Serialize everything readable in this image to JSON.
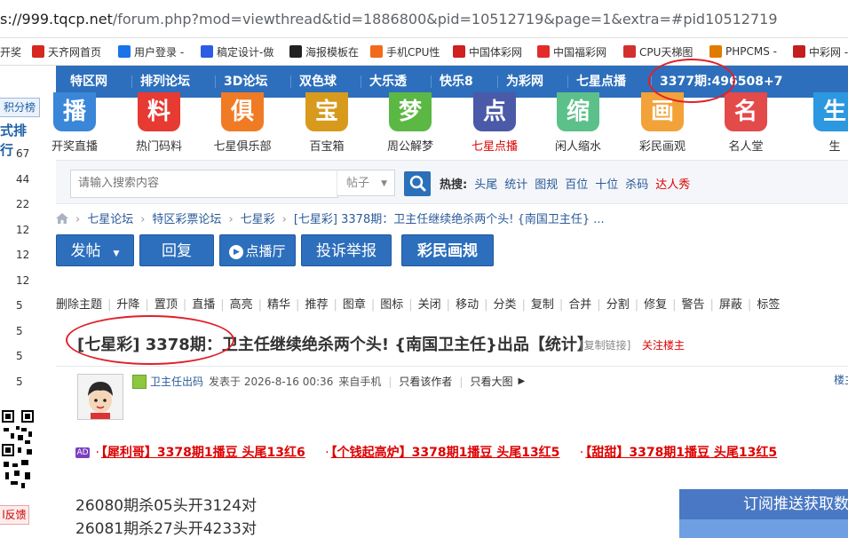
{
  "address_bar": {
    "url_host": "s://999.tqcp.net",
    "url_rest": "/forum.php?mod=viewthread&tid=1886800&pid=10512719&page=1&extra=#pid10512719"
  },
  "bookmarks": [
    {
      "label": "开奖",
      "icon": "page-icon",
      "color": "#888888"
    },
    {
      "label": "天齐网首页",
      "icon": "tianqi-logo-icon",
      "color": "#d6281f"
    },
    {
      "label": "用户登录 -",
      "icon": "globe-icon",
      "color": "#1a73e8"
    },
    {
      "label": "稿定设计-做",
      "icon": "gaoding-icon",
      "color": "#2d5be3"
    },
    {
      "label": "海报模板在",
      "icon": "poster-icon",
      "color": "#222222"
    },
    {
      "label": "手机CPU性",
      "icon": "cpu-icon",
      "color": "#f26a1b"
    },
    {
      "label": "中国体彩网",
      "icon": "sports-lottery-icon",
      "color": "#d02020"
    },
    {
      "label": "中国福彩网",
      "icon": "welfare-lottery-icon",
      "color": "#e32b2b"
    },
    {
      "label": "CPU天梯图",
      "icon": "cpu-ladder-icon",
      "color": "#d22f2f"
    },
    {
      "label": "PHPCMS -",
      "icon": "phpcms-icon",
      "color": "#e07b00"
    },
    {
      "label": "中彩网 -",
      "icon": "zhongcai-icon",
      "color": "#c41e1e"
    }
  ],
  "sidebar": {
    "rank_button": "积分榜",
    "rank_title": "式排行",
    "numbers": [
      "67",
      "44",
      "22",
      "12",
      "12",
      "12",
      "5",
      "5",
      "5",
      "5"
    ],
    "feedback": "l反馈"
  },
  "nav": {
    "items": [
      "特区网",
      "排列论坛",
      "3D论坛",
      "双色球",
      "大乐透",
      "快乐8",
      "为彩网",
      "七星点播",
      "3377期:496508+7"
    ]
  },
  "icon_row": [
    {
      "char": "播",
      "label": "开奖直播",
      "color": "#3a86d8",
      "red": false
    },
    {
      "char": "料",
      "label": "热门码料",
      "color": "#e63a32",
      "red": false
    },
    {
      "char": "俱",
      "label": "七星俱乐部",
      "color": "#f07b25",
      "red": false
    },
    {
      "char": "宝",
      "label": "百宝箱",
      "color": "#d89a1c",
      "red": false
    },
    {
      "char": "梦",
      "label": "周公解梦",
      "color": "#5cb845",
      "red": false
    },
    {
      "char": "点",
      "label": "七星点播",
      "color": "#4a5aa8",
      "red": true
    },
    {
      "char": "缩",
      "label": "闲人缩水",
      "color": "#5cc08a",
      "red": false
    },
    {
      "char": "画",
      "label": "彩民画观",
      "color": "#f2a238",
      "red": false
    },
    {
      "char": "名",
      "label": "名人堂",
      "color": "#e34a4a",
      "red": false
    },
    {
      "char": "生",
      "label": "生",
      "color": "#2c98e0",
      "red": false
    }
  ],
  "search": {
    "placeholder": "请输入搜索内容",
    "type_select": "帖子",
    "hot_label": "热搜:",
    "hot_items": [
      "头尾",
      "统计",
      "图规",
      "百位",
      "十位",
      "杀码"
    ],
    "hot_red": "达人秀"
  },
  "breadcrumb": [
    "七星论坛",
    "特区彩票论坛",
    "七星彩",
    "[七星彩] 3378期：卫主任继续绝杀两个头! {南国卫主任} ..."
  ],
  "actions": {
    "post": "发帖",
    "reply": "回复",
    "live": "点播厅",
    "report": "投诉举报",
    "rules": "彩民画规"
  },
  "mod_tools": [
    "删除主题",
    "升降",
    "置顶",
    "直播",
    "高亮",
    "精华",
    "推荐",
    "图章",
    "图标",
    "关闭",
    "移动",
    "分类",
    "复制",
    "合并",
    "分割",
    "修复",
    "警告",
    "屏蔽",
    "标签"
  ],
  "thread": {
    "title": "[七星彩] 3378期：卫主任继续绝杀两个头! {南国卫主任}出品【统计】",
    "copy_link": "[复制链接]",
    "follow": "关注楼主"
  },
  "post": {
    "author": "卫主任出码",
    "posted": "发表于 2026-8-16 00:36",
    "from": "来自手机",
    "only_author": "只看该作者",
    "only_images": "只看大图",
    "floor": "楼主",
    "ad_badge": "AD",
    "ad_links": [
      "【犀利哥】3378期1播豆 头尾13红6",
      "【个钱起高炉】3378期1播豆 头尾13红5",
      "【甜甜】3378期1播豆 头尾13红5"
    ],
    "lines": [
      "26080期杀05头开3124对",
      "26081期杀27头开4233对"
    ],
    "subscribe": "订阅推送获取数"
  },
  "colors": {
    "nav_blue": "#2d6fbc",
    "link_blue": "#2a5a9a",
    "accent_red": "#dd0000",
    "annotation_red": "#e0202a"
  }
}
